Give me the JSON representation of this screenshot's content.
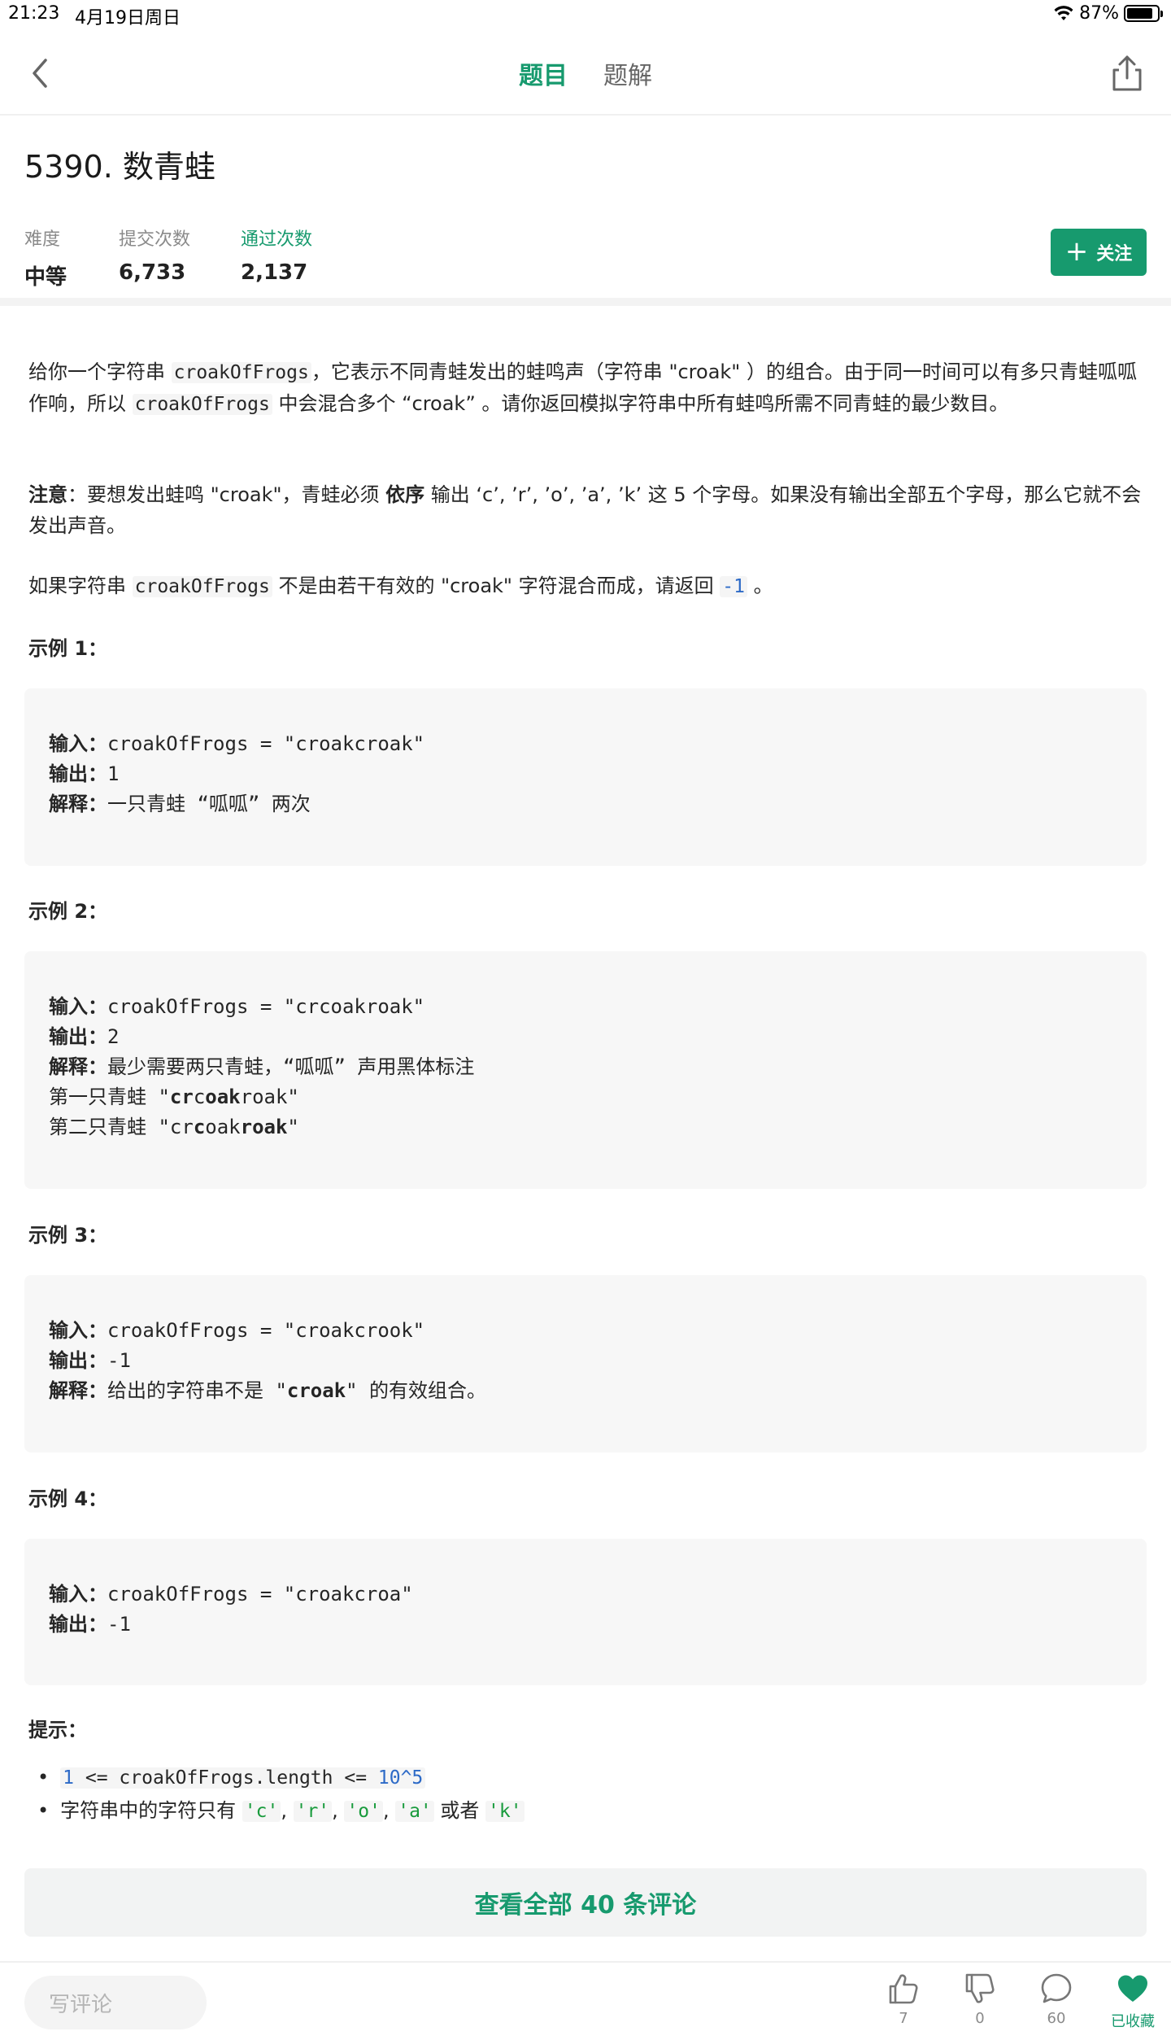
{
  "status_bar": {
    "time": "21:23",
    "date": "4月19日周日",
    "battery": "87%"
  },
  "nav": {
    "tab_question": "题目",
    "tab_solution": "题解"
  },
  "problem": {
    "title": "5390. 数青蛙",
    "difficulty_label": "难度",
    "difficulty_value": "中等",
    "submissions_label": "提交次数",
    "submissions_value": "6,733",
    "accepted_label": "通过次数",
    "accepted_value": "2,137",
    "follow_label": "关注"
  },
  "description": {
    "p1_a": "给你一个字符串 ",
    "p1_code": "croakOfFrogs",
    "p1_b": "，它表示不同青蛙发出的蛙鸣声（字符串 \"croak\" ）的组合。由于同一时间可以有多只青蛙呱呱作响，所以 ",
    "p1_code2": "croakOfFrogs",
    "p1_c": " 中会混合多个 “croak” 。请你返回模拟字符串中所有蛙鸣所需不同青蛙的最少数目。",
    "p2_note": "注意",
    "p2_a": "：要想发出蛙鸣 \"croak\"，青蛙必须 ",
    "p2_bold": "依序",
    "p2_b": " 输出 ‘c’, ’r’, ’o’, ’a’, ’k’ 这 5 个字母。如果没有输出全部五个字母，那么它就不会发出声音。",
    "p3_a": "如果字符串 ",
    "p3_code": "croakOfFrogs",
    "p3_b": " 不是由若干有效的 \"croak\" 字符混合而成，请返回 ",
    "p3_num": "-1",
    "p3_c": " 。"
  },
  "examples": [
    {
      "title": "示例 1：",
      "input_label": "输入：",
      "input": "croakOfFrogs = \"croakcroak\"",
      "output_label": "输出：",
      "output": "1",
      "explain_label": "解释：",
      "explain": "一只青蛙 “呱呱” 两次"
    },
    {
      "title": "示例 2：",
      "input_label": "输入：",
      "input": "croakOfFrogs = \"crcoakroak\"",
      "output_label": "输出：",
      "output": "2",
      "explain_label": "解释：",
      "explain": "最少需要两只青蛙，“呱呱” 声用黑体标注",
      "line4_prefix": "第一只青蛙 \"",
      "line4_b1": "cr",
      "line4_n1": "c",
      "line4_b2": "oak",
      "line4_n2": "roak",
      "line4_suffix": "\"",
      "line5_prefix": "第二只青蛙 \"",
      "line5_n1": "cr",
      "line5_b1": "c",
      "line5_n2": "oak",
      "line5_b2": "roak",
      "line5_suffix": "\""
    },
    {
      "title": "示例 3：",
      "input_label": "输入：",
      "input": "croakOfFrogs = \"croakcrook\"",
      "output_label": "输出：",
      "output": "-1",
      "explain_label": "解释：",
      "explain_a": "给出的字符串不是 \"",
      "explain_bold": "croak",
      "explain_b": "\" 的有效组合。"
    },
    {
      "title": "示例 4：",
      "input_label": "输入：",
      "input": "croakOfFrogs = \"croakcroa\"",
      "output_label": "输出：",
      "output": "-1"
    }
  ],
  "hints": {
    "title": "提示：",
    "h1_num1": "1",
    "h1_mid": " <= croakOfFrogs.length <= ",
    "h1_num2": "10^5",
    "h2_text": "字符串中的字符只有 ",
    "h2_c": "'c'",
    "h2_r": "'r'",
    "h2_o": "'o'",
    "h2_a": "'a'",
    "h2_or": " 或者 ",
    "h2_k": "'k'",
    "sep": ", "
  },
  "comments_button": "查看全部 40 条评论",
  "bottom_bar": {
    "write_placeholder": "写评论",
    "likes": "7",
    "dislikes": "0",
    "comments": "60",
    "favorite": "已收藏"
  },
  "colors": {
    "accent": "#179a6e",
    "code_bg": "#f7f7f7",
    "code_number": "#2d6ac7",
    "code_string": "#189b3c"
  }
}
